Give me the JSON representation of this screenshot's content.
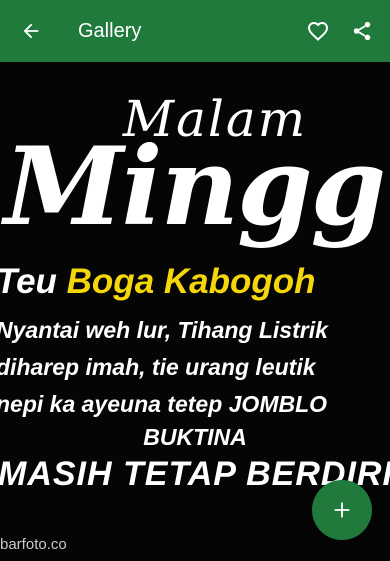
{
  "appbar": {
    "title": "Gallery",
    "back_icon": "arrow-left-icon",
    "favorite_icon": "heart-outline-icon",
    "share_icon": "share-icon"
  },
  "image": {
    "line1": "Malam",
    "line2": "Minggu",
    "sub_prefix": "Teu ",
    "sub_highlight": "Boga Kabogoh",
    "body1": "Nyantai weh lur, Tihang Listrik",
    "body2": "diharep imah, tie urang leutik",
    "body3": "nepi ka ayeuna tetep JOMBLO",
    "body4": "BUKTINA",
    "big": "MASIH TETAP BERDIRI",
    "watermark": "barfoto.co"
  },
  "fab": {
    "icon": "plus-icon"
  },
  "colors": {
    "primary": "#1f7a3c",
    "highlight": "#f5d60a"
  }
}
